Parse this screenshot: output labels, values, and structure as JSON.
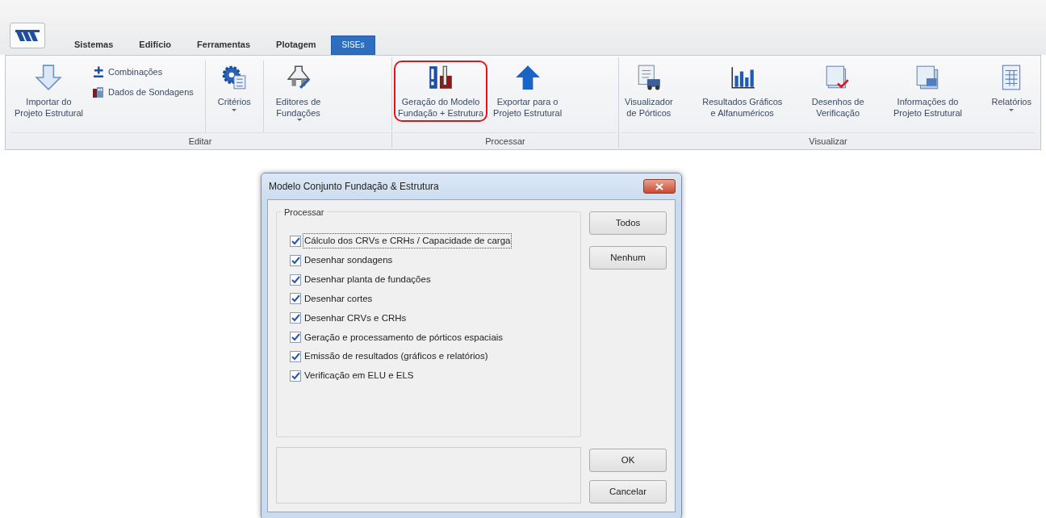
{
  "tabs": [
    {
      "label": "Sistemas",
      "selected": false
    },
    {
      "label": "Edifício",
      "selected": false
    },
    {
      "label": "Ferramentas",
      "selected": false
    },
    {
      "label": "Plotagem",
      "selected": false
    },
    {
      "label": "SISEs",
      "selected": true
    }
  ],
  "ribbon": {
    "groups": [
      {
        "label": "Editar",
        "items": [
          {
            "kind": "large",
            "lines": [
              "Importar do",
              "Projeto Estrutural"
            ],
            "dropdown": false,
            "highlighted": false
          },
          {
            "kind": "stack",
            "items": [
              {
                "label": "Combinações"
              },
              {
                "label": "Dados de Sondagens"
              }
            ]
          },
          {
            "kind": "separator"
          },
          {
            "kind": "large",
            "lines": [
              "Critérios"
            ],
            "dropdown": true,
            "highlighted": false
          },
          {
            "kind": "separator"
          },
          {
            "kind": "large",
            "lines": [
              "Editores de",
              "Fundações"
            ],
            "dropdown": true,
            "highlighted": false
          }
        ]
      },
      {
        "label": "Processar",
        "items": [
          {
            "kind": "large",
            "lines": [
              "Geração do Modelo",
              "Fundação + Estrutura"
            ],
            "dropdown": false,
            "highlighted": true
          },
          {
            "kind": "large",
            "lines": [
              "Exportar para o",
              "Projeto Estrutural"
            ],
            "dropdown": false,
            "highlighted": false
          }
        ]
      },
      {
        "label": "Visualizar",
        "items": [
          {
            "kind": "large",
            "lines": [
              "Visualizador",
              "de Pórticos"
            ],
            "dropdown": false,
            "highlighted": false
          },
          {
            "kind": "large",
            "lines": [
              "Resultados Gráficos",
              "e Alfanuméricos"
            ],
            "dropdown": false,
            "highlighted": false
          },
          {
            "kind": "large",
            "lines": [
              "Desenhos de",
              "Verificação"
            ],
            "dropdown": false,
            "highlighted": false
          },
          {
            "kind": "large",
            "lines": [
              "Informações do",
              "Projeto Estrutural"
            ],
            "dropdown": false,
            "highlighted": false
          },
          {
            "kind": "large",
            "lines": [
              "Relatórios"
            ],
            "dropdown": true,
            "highlighted": false
          }
        ]
      }
    ]
  },
  "dialog": {
    "title": "Modelo Conjunto Fundação & Estrutura",
    "group_label": "Processar",
    "options": [
      {
        "label": "Cálculo dos CRVs e CRHs / Capacidade de carga",
        "checked": true,
        "focused": true
      },
      {
        "label": "Desenhar sondagens",
        "checked": true,
        "focused": false
      },
      {
        "label": "Desenhar planta de fundações",
        "checked": true,
        "focused": false
      },
      {
        "label": "Desenhar cortes",
        "checked": true,
        "focused": false
      },
      {
        "label": "Desenhar CRVs e CRHs",
        "checked": true,
        "focused": false
      },
      {
        "label": "Geração e processamento de pórticos espaciais",
        "checked": true,
        "focused": false
      },
      {
        "label": "Emissão de resultados (gráficos e relatórios)",
        "checked": true,
        "focused": false
      },
      {
        "label": "Verificação em ELU e ELS",
        "checked": true,
        "focused": false
      }
    ],
    "side_buttons": [
      "Todos",
      "Nenhum"
    ],
    "bottom_buttons": [
      "OK",
      "Cancelar"
    ]
  }
}
